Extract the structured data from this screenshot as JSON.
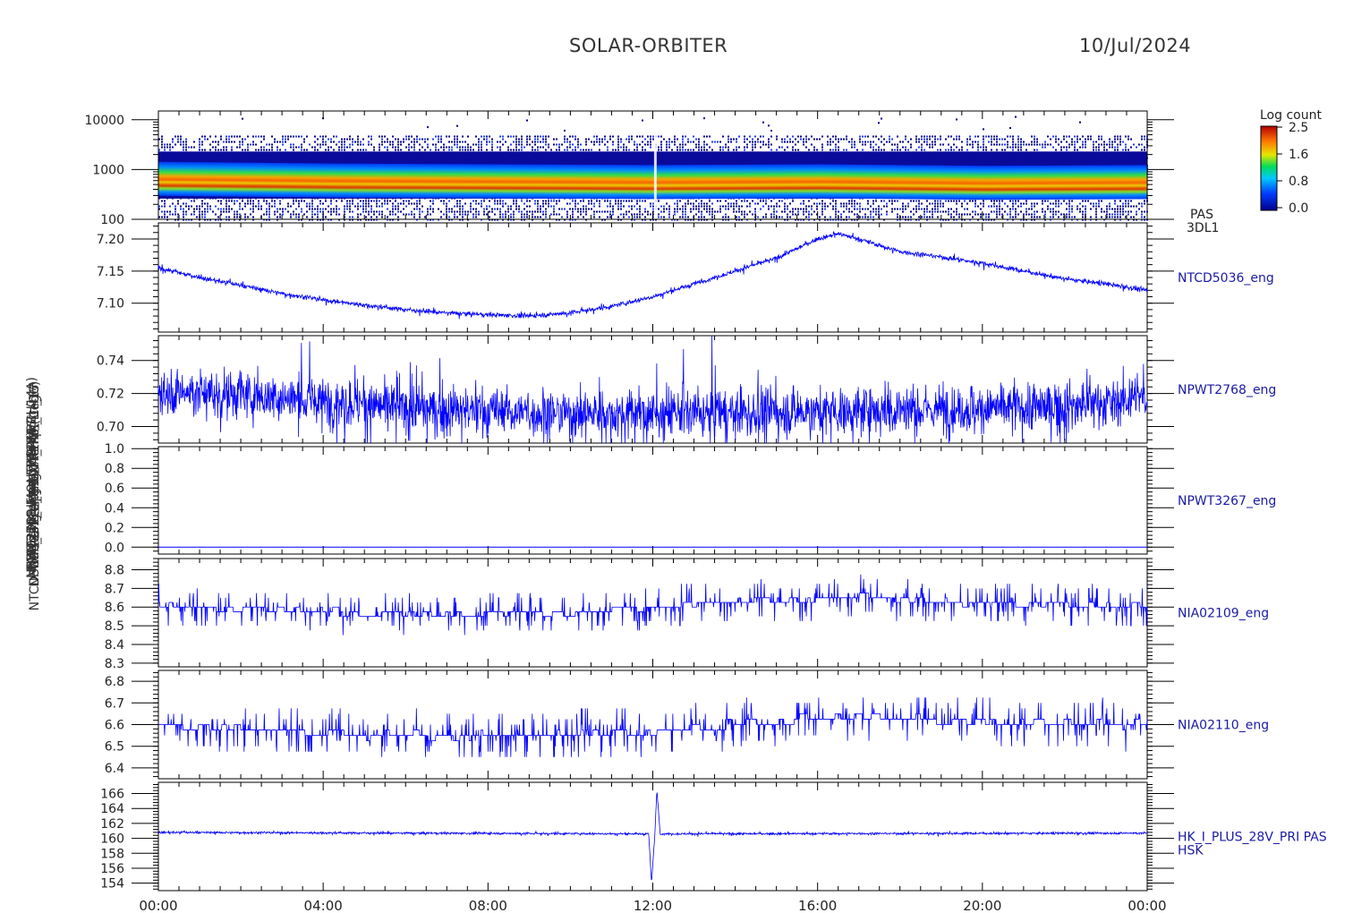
{
  "header": {
    "mission": "SOLAR-ORBITER",
    "date": "10/Jul/2024"
  },
  "colorbar": {
    "title": "Log count",
    "ticks": [
      "2.5",
      "1.6",
      "0.8",
      "0.0"
    ]
  },
  "left_labels": [
    "PAS_3DL1 Energy (eV)",
    "NTCD5036_eng Approx Temp (DegC)",
    "NPWT2768_eng SWA EAS ...",
    "NPWT3267_eng SWA_HTR_..._17",
    "NIA02109_eng THERM_CH14",
    "NIA02110_eng THERM_CH15",
    "PAS_HK_IMON_P28V PRI (mA)"
  ],
  "x_ticks": [
    "00:00",
    "04:00",
    "08:00",
    "12:00",
    "16:00",
    "20:00",
    "00:00"
  ],
  "colors": {
    "line": "#0000ff",
    "frame": "#000000",
    "label": "#1a1aa6"
  },
  "chart_data": [
    {
      "type": "heatmap",
      "name": "PAS 3DL1",
      "right_label": [
        "PAS",
        "3DL1"
      ],
      "ylabel": "Energy (eV)",
      "yscale": "log",
      "ylim": [
        100,
        15000
      ],
      "yticks": [
        100,
        1000,
        10000
      ],
      "ytick_labels": [
        "100",
        "1000",
        "10000"
      ],
      "xlim": [
        0,
        24
      ],
      "band_energy_eV": [
        [
          0,
          650
        ],
        [
          4.3,
          600
        ],
        [
          12,
          560
        ],
        [
          16,
          580
        ],
        [
          20,
          540
        ],
        [
          24,
          560
        ]
      ],
      "value_range_log_count": [
        0.0,
        2.5
      ]
    },
    {
      "type": "line",
      "name": "NTCD5036_eng",
      "right_label": [
        "NTCD5036_eng"
      ],
      "ylabel": "Approx Temp (DegC)",
      "ylim": [
        7.055,
        7.225
      ],
      "yticks": [
        7.1,
        7.15,
        7.2
      ],
      "ytick_labels": [
        "7.10",
        "7.15",
        "7.20"
      ],
      "x": [
        0,
        1,
        2,
        3,
        4,
        5,
        6,
        7,
        8,
        9,
        10,
        11,
        12,
        13,
        14,
        15,
        16,
        16.5,
        17,
        18,
        19,
        20,
        21,
        22,
        23,
        24
      ],
      "y": [
        7.155,
        7.14,
        7.128,
        7.115,
        7.105,
        7.097,
        7.09,
        7.085,
        7.082,
        7.08,
        7.085,
        7.095,
        7.11,
        7.13,
        7.15,
        7.17,
        7.2,
        7.208,
        7.2,
        7.18,
        7.172,
        7.162,
        7.15,
        7.138,
        7.13,
        7.12
      ],
      "noise": 0.003
    },
    {
      "type": "line",
      "name": "NPWT2768_eng",
      "right_label": [
        "NPWT2768_eng"
      ],
      "ylim": [
        0.69,
        0.755
      ],
      "yticks": [
        0.7,
        0.72,
        0.74
      ],
      "ytick_labels": [
        "0.70",
        "0.72",
        "0.74"
      ],
      "x": [
        0,
        2,
        4,
        6,
        8,
        10,
        12,
        14,
        16,
        18,
        20,
        22,
        24
      ],
      "y": [
        0.722,
        0.719,
        0.715,
        0.711,
        0.709,
        0.708,
        0.708,
        0.708,
        0.709,
        0.71,
        0.711,
        0.712,
        0.718
      ],
      "noise": 0.012
    },
    {
      "type": "line",
      "name": "NPWT3267_eng",
      "right_label": [
        "NPWT3267_eng"
      ],
      "ylim": [
        -0.07,
        1.02
      ],
      "yticks": [
        0.0,
        0.2,
        0.4,
        0.6,
        0.8,
        1.0
      ],
      "ytick_labels": [
        "0.0",
        "0.2",
        "0.4",
        "0.6",
        "0.8",
        "1.0"
      ],
      "x": [
        0,
        24
      ],
      "y": [
        0.0,
        0.0
      ],
      "noise": 0
    },
    {
      "type": "line",
      "name": "NIA02109_eng",
      "right_label": [
        "NIA02109_eng"
      ],
      "ylabel": "THERM_CH14",
      "ylim": [
        8.28,
        8.86
      ],
      "yticks": [
        8.3,
        8.4,
        8.5,
        8.6,
        8.7,
        8.8
      ],
      "ytick_labels": [
        "8.3",
        "8.4",
        "8.5",
        "8.6",
        "8.7",
        "8.8"
      ],
      "x": [
        0,
        1,
        4,
        4.5,
        7,
        9,
        10,
        10.5,
        12,
        14,
        17,
        20,
        24
      ],
      "y": [
        8.62,
        8.6,
        8.58,
        8.57,
        8.56,
        8.57,
        8.55,
        8.58,
        8.6,
        8.63,
        8.65,
        8.62,
        8.61
      ],
      "noise": 0.05,
      "quantum": 0.025
    },
    {
      "type": "line",
      "name": "NIA02110_eng",
      "right_label": [
        "NIA02110_eng"
      ],
      "ylabel": "THERM_CH15",
      "ylim": [
        6.35,
        6.85
      ],
      "yticks": [
        6.4,
        6.5,
        6.6,
        6.7,
        6.8
      ],
      "ytick_labels": [
        "6.4",
        "6.5",
        "6.6",
        "6.7",
        "6.8"
      ],
      "x": [
        0,
        1,
        4,
        7,
        9,
        10,
        12,
        14,
        17,
        20,
        24
      ],
      "y": [
        6.6,
        6.58,
        6.56,
        6.55,
        6.55,
        6.55,
        6.57,
        6.6,
        6.64,
        6.61,
        6.6
      ],
      "noise": 0.05,
      "quantum": 0.025
    },
    {
      "type": "line",
      "name": "HK_I_PLUS_28V_PRI",
      "right_label": [
        "HK_I_PLUS_28V_PRI PAS",
        "HSK"
      ],
      "ylabel": "PAS_HK_IMON_P28V PRI (mA)",
      "ylim": [
        153,
        167.5
      ],
      "yticks": [
        154,
        156,
        158,
        160,
        162,
        164,
        166
      ],
      "ytick_labels": [
        "154",
        "156",
        "158",
        "160",
        "162",
        "164",
        "166"
      ],
      "x": [
        0,
        11.9,
        11.97,
        12.05,
        12.1,
        12.18,
        12.25,
        24
      ],
      "y": [
        160.8,
        160.6,
        154.0,
        160.5,
        166.5,
        160.6,
        160.6,
        160.7
      ],
      "noise": 0.12
    }
  ]
}
